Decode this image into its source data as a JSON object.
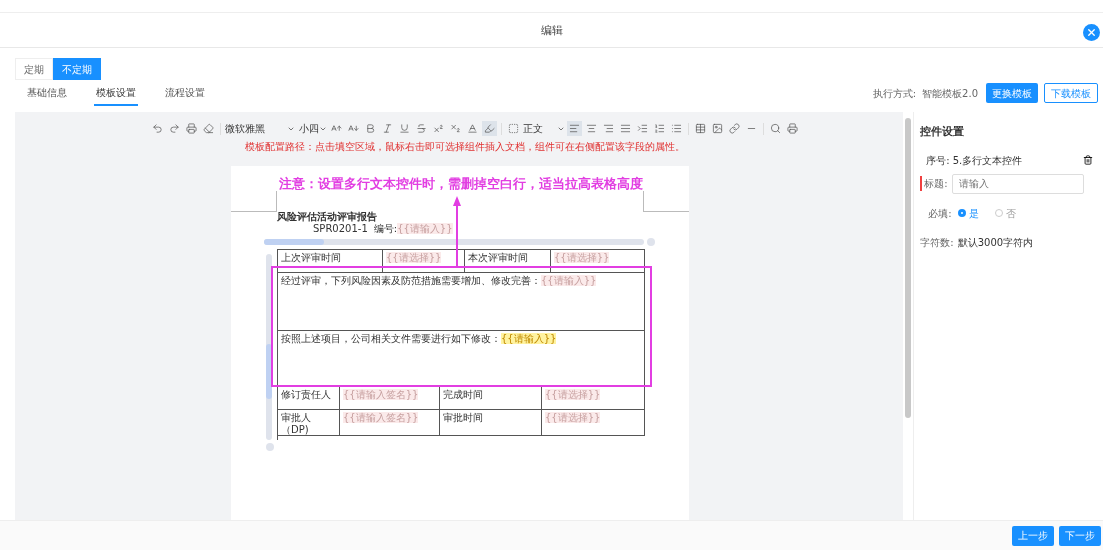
{
  "dialog": {
    "title": "编辑"
  },
  "period_toggle": [
    {
      "label": "定期",
      "selected": false
    },
    {
      "label": "不定期",
      "selected": true
    }
  ],
  "tabs": [
    {
      "label": "基础信息",
      "selected": false
    },
    {
      "label": "模板设置",
      "selected": true
    },
    {
      "label": "流程设置",
      "selected": false
    }
  ],
  "execution": {
    "label": "执行方式:",
    "value": "智能模板2.0",
    "buttons": [
      {
        "label": "更换模板",
        "kind": "primary"
      },
      {
        "label": "下载模板",
        "kind": "outline"
      }
    ]
  },
  "toolbar": {
    "font": "微软雅黑",
    "size": "小四",
    "paragraph_style": "正文",
    "hint": "模板配置路径：点击填空区域，鼠标右击即可选择组件插入文档，组件可在右侧配置该字段的属性。"
  },
  "document": {
    "annotation": "注意：设置多行文本控件时，需删掉空白行，适当拉高表格高度",
    "title": "风险评估活动评审报告",
    "code": "SPR0201-1",
    "number_label": "编号:",
    "number_token": "{{请输入}}",
    "rows": [
      {
        "kind": "quad-a",
        "cells": [
          {
            "text": "上次评审时间"
          },
          {
            "token": "{{请选择}}",
            "highlighted": false
          },
          {
            "text": "本次评审时间"
          },
          {
            "token": "{{请选择}}",
            "highlighted": false
          }
        ]
      },
      {
        "kind": "wide",
        "cells": [
          {
            "text": "经过评审，下列风险因素及防范措施需要增加、修改完善：",
            "token": "{{请输入}}",
            "highlighted": false
          }
        ]
      },
      {
        "kind": "wide",
        "cells": [
          {
            "text": "按照上述项目，公司相关文件需要进行如下修改：",
            "token": "{{请输入}}",
            "highlighted": true
          }
        ]
      },
      {
        "kind": "quad-b",
        "cells": [
          {
            "text": "修订责任人"
          },
          {
            "token": "{{请输入签名}}",
            "highlighted": false
          },
          {
            "text": "完成时间"
          },
          {
            "token": "{{请选择}}",
            "highlighted": false
          }
        ]
      },
      {
        "kind": "quad-b",
        "cells": [
          {
            "text": "审批人（DP)"
          },
          {
            "token": "{{请输入签名}}",
            "highlighted": false
          },
          {
            "text": "审批时间"
          },
          {
            "token": "{{请选择}}",
            "highlighted": false
          }
        ]
      }
    ]
  },
  "control_settings": {
    "title": "控件设置",
    "index_label": "序号:",
    "index_value": "5.多行文本控件",
    "title_label": "标题:",
    "title_required": true,
    "title_value": "请输入",
    "required_label": "必填:",
    "required_options": [
      {
        "label": "是",
        "selected": true
      },
      {
        "label": "否",
        "selected": false
      }
    ],
    "chars_label": "字符数:",
    "chars_value": "默认3000字符内"
  },
  "footer": {
    "buttons": [
      "上一步",
      "下一步"
    ]
  }
}
